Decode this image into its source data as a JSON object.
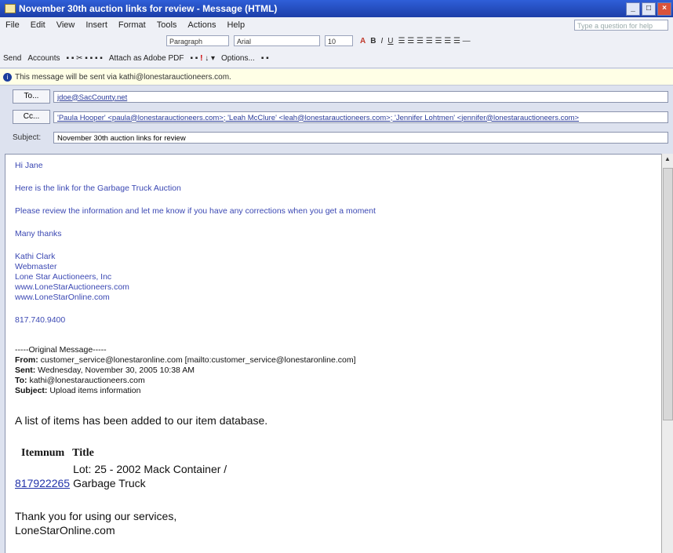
{
  "window": {
    "title": "November 30th auction links for review - Message (HTML)",
    "controls": [
      "_",
      "□",
      "×"
    ]
  },
  "menu": {
    "items": [
      "File",
      "Edit",
      "View",
      "Insert",
      "Format",
      "Tools",
      "Actions",
      "Help"
    ],
    "help_placeholder": "Type a question for help"
  },
  "format_bar": {
    "style": "Paragraph",
    "font": "Arial",
    "size": "10",
    "buttons": [
      "A",
      "B",
      "I",
      "U"
    ]
  },
  "toolbar": {
    "send": "Send",
    "accounts": "Accounts",
    "attach_pdf": "Attach as Adobe PDF",
    "options": "Options..."
  },
  "infobar": {
    "text": "This message will be sent via kathi@lonestarauctioneers.com."
  },
  "header": {
    "to_label": "To...",
    "to_value": "jdoe@SacCounty.net",
    "cc_label": "Cc...",
    "cc_value": "'Paula Hooper' <paula@lonestarauctioneers.com>; 'Leah McClure' <leah@lonestarauctioneers.com>; 'Jennifer Lohtmen' <jennifer@lonestarauctioneers.com>",
    "subject_label": "Subject:",
    "subject_value": "November 30th auction links for review"
  },
  "body": {
    "greeting": "Hi Jane",
    "line1": "Here is the link for the Garbage Truck Auction",
    "line2": "Please review the information and let me know if you have any corrections when you get a moment",
    "thanks": "Many thanks",
    "sig_name": "Kathi Clark",
    "sig_title": "Webmaster",
    "sig_company": "Lone Star Auctioneers, Inc",
    "sig_url1": "www.LoneStarAuctioneers.com",
    "sig_url2": "www.LoneStarOnline.com",
    "sig_phone": "817.740.9400"
  },
  "original": {
    "divider": "-----Original Message-----",
    "from_label": "From:",
    "from_value": "customer_service@lonestaronline.com [mailto:customer_service@lonestaronline.com]",
    "sent_label": "Sent:",
    "sent_value": "Wednesday, November 30, 2005 10:38 AM",
    "to_label": "To:",
    "to_value": "kathi@lonestarauctioneers.com",
    "subject_label": "Subject:",
    "subject_value": "Upload items information"
  },
  "content": {
    "intro": "A list of items has been added to our item database.",
    "col_itemnum": "Itemnum",
    "col_title": "Title",
    "item_num": "817922265",
    "item_title_line1": "Lot: 25 - 2002 Mack Container /",
    "item_title_line2": "Garbage Truck",
    "closing1": "Thank you for using our services,",
    "closing2": "LoneStarOnline.com"
  }
}
